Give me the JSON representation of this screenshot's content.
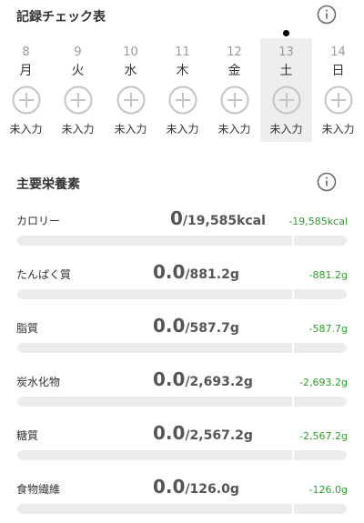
{
  "check_section": {
    "title": "記録チェック表",
    "info_icon": "info-circle-icon"
  },
  "calendar": {
    "days": [
      {
        "date": "8",
        "weekday": "月",
        "status": "未入力",
        "selected": false
      },
      {
        "date": "9",
        "weekday": "火",
        "status": "未入力",
        "selected": false
      },
      {
        "date": "10",
        "weekday": "水",
        "status": "未入力",
        "selected": false
      },
      {
        "date": "11",
        "weekday": "木",
        "status": "未入力",
        "selected": false
      },
      {
        "date": "12",
        "weekday": "金",
        "status": "未入力",
        "selected": false
      },
      {
        "date": "13",
        "weekday": "土",
        "status": "未入力",
        "selected": true
      },
      {
        "date": "14",
        "weekday": "日",
        "status": "未入力",
        "selected": false
      }
    ],
    "add_icon": "plus-circle-icon",
    "today_marker_icon": "dot-icon"
  },
  "nutrients_section": {
    "title": "主要栄養素",
    "info_icon": "info-circle-icon"
  },
  "nutrients": [
    {
      "name": "カロリー",
      "current": "0",
      "target": "/19,585kcal",
      "diff": "-19,585kcal",
      "progress": 0
    },
    {
      "name": "たんぱく質",
      "current": "0.0",
      "target": "/881.2g",
      "diff": "-881.2g",
      "progress": 0
    },
    {
      "name": "脂質",
      "current": "0.0",
      "target": "/587.7g",
      "diff": "-587.7g",
      "progress": 0
    },
    {
      "name": "炭水化物",
      "current": "0.0",
      "target": "/2,693.2g",
      "diff": "-2,693.2g",
      "progress": 0
    },
    {
      "name": "糖質",
      "current": "0.0",
      "target": "/2,567.2g",
      "diff": "-2,567.2g",
      "progress": 0
    },
    {
      "name": "食物繊維",
      "current": "0.0",
      "target": "/126.0g",
      "diff": "-126.0g",
      "progress": 0
    }
  ],
  "colors": {
    "accent_green": "#2e9e2e",
    "bar_track": "#ececec",
    "selected_day_bg": "#eeeeee"
  }
}
